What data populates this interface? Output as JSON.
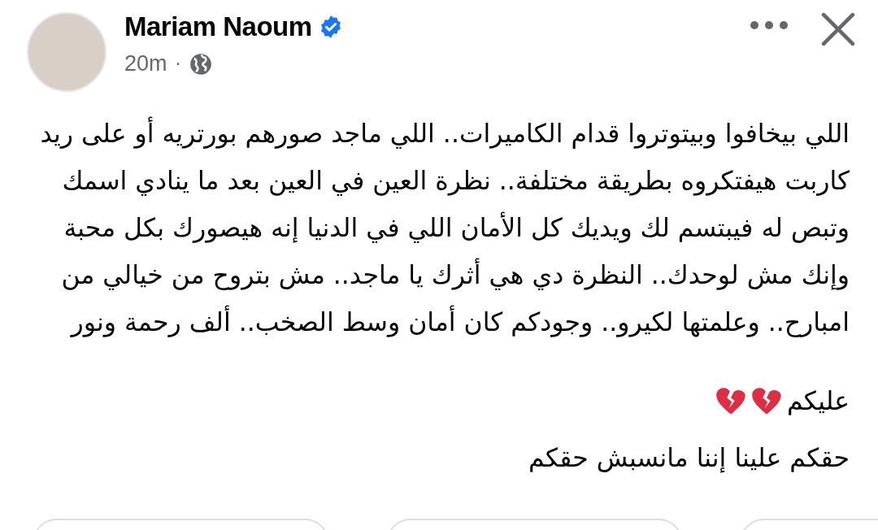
{
  "post": {
    "author": "Mariam Naoum",
    "verified": true,
    "time": "20m",
    "separator": "·",
    "lines": [
      {
        "text": "اللي بيخافوا وبيتوتروا قدام الكاميرات.. اللي ماجد صورهم بورتريه أو على ريد"
      },
      {
        "text": "كاربت هيفتكروه بطريقة مختلفة.. نظرة العين في العين بعد ما ينادي اسمك"
      },
      {
        "text": "وتبص له فيبتسم لك ويديك كل الأمان اللي في الدنيا إنه هيصورك بكل محبة"
      },
      {
        "text": "وإنك مش لوحدك.. النظرة دي هي أثرك يا ماجد.. مش بتروح من خيالي من"
      },
      {
        "text": "امبارح.. وعلمتها لكيرو.. وجودكم كان أمان وسط الصخب.. ألف رحمة ونور"
      },
      {
        "text": "عليكم",
        "emoji": [
          {
            "kind": "broken-heart"
          },
          {
            "kind": "broken-heart"
          }
        ]
      },
      {
        "text": "حقكم علينا إننا مانسبش حقكم"
      }
    ]
  },
  "actions": [
    {
      "kind": "pill"
    },
    {
      "kind": "pill"
    },
    {
      "kind": "pill"
    }
  ]
}
